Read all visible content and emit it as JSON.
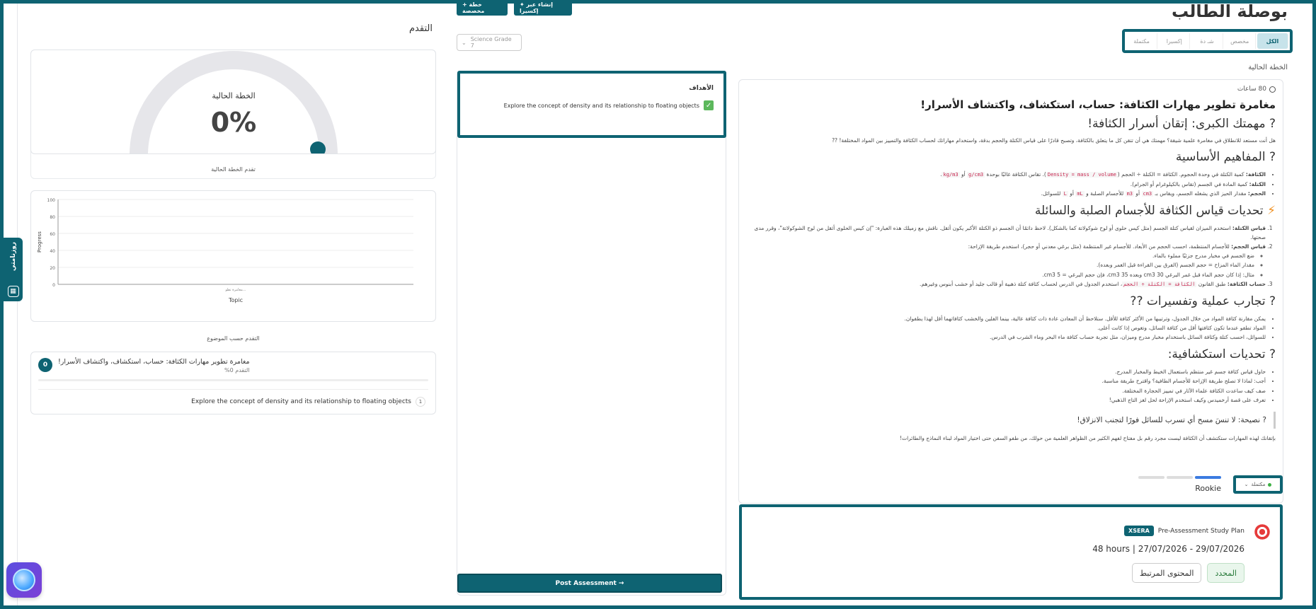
{
  "header": {
    "title": "بوصلة الطالب",
    "filters": [
      "الكل",
      "مخصص",
      "شـ دة",
      "إكسيرا",
      "مكتملة"
    ],
    "current_plan_label": "الخطة الحالية",
    "create_xsera_btn": "✦ إنشاء عبر إكسيرا",
    "custom_plan_btn": "+ خطة مخصصة",
    "grade_select": "Science Grade 7"
  },
  "lesson": {
    "hours": "80 ساعات",
    "title": "مغامرة تطوير مهارات الكثافة: حساب، استكشاف، واكتشاف الأسرار!",
    "mission_heading": "? مهمتك الكبرى: إتقان أسرار الكثافة!",
    "mission_text": "هل أنت مستعد للانطلاق في مغامرة علمية شيقة؟ مهمتك هي أن تتقن كل ما يتعلق بالكثافة، وتصبح قادرًا على قياس الكتلة والحجم بدقة، واستخدام مهاراتك لحساب الكثافة والتمييز بين المواد المختلفة! ??",
    "concepts_heading": "? المفاهيم الأساسية",
    "concepts": [
      {
        "term": "الكثافة:",
        "text": "كمية الكتلة في وحدة الحجوم. الكثافة = الكتلة ÷ الحجم (",
        "code1": "Density = mass / volume",
        "mid": "). تقاس الكثافة غالبًا بوحدة ",
        "code2": "g/cm3",
        "or": " أو ",
        "code3": "kg/m3",
        "end": "."
      },
      {
        "term": "الكتلة:",
        "text": "كمية المادة في الجسم (تقاس بالكيلوغرام أو الجرام)."
      },
      {
        "term": "الحجم:",
        "text": "مقدار الحيز الذي يشغله الجسم، ويقاس بـ ",
        "code1": "cm3",
        "or": " أو ",
        "code2": "m3",
        "mid": " للأجسام الصلبة و ",
        "code3": "mL",
        "or2": " أو ",
        "code4": "L",
        "end": " للسوائل."
      }
    ],
    "challenges_heading": "تحديات قياس الكثافة للأجسام الصلبة والسائلة",
    "challenges": [
      {
        "term": "قياس الكتلة:",
        "text": "استخدم الميزان لقياس كتلة الجسم (مثل كيس حلوى أو لوح شوكولاتة كما بالشكل). لاحظ دائمًا أن الجسم ذو الكتلة الأكبر يكون أثقل. ناقش مع زميلك هذه العبارة: \"إن كيس الحلوى أثقل من لوح الشوكولاتة\"، وقرر مدى صحتها."
      },
      {
        "term": "قياس الحجم:",
        "text": "للأجسام المنتظمة، احسب الحجم من الأبعاد. للأجسام غير المنتظمة (مثل برغي معدني أو حجر)، استخدم طريقة الإزاحة:",
        "sub": [
          "ضع الجسم في مخبار مدرج جزئيًا مملوء بالماء.",
          "مقدار الماء المزاح = حجم الجسم (الفرق بين القراءة قبل الغمر وبعده).",
          "مثال: إذا كان حجم الماء قبل غمر البرغي 30 cm3 وبعده 35 cm3، فإن حجم البرغي = 5 cm3."
        ]
      },
      {
        "term": "حساب الكثافة:",
        "text": "طبق القانون ",
        "code1": "الكثافة = الكتلة ÷ الحجم",
        "end": "، استخدم الجدول في الدرس لحساب كثافة كتلة ذهبية أو قالب جليد أو خشب أبنوس وغيرهم."
      }
    ],
    "experiments_heading": "? تجارب عملية وتفسيرات ??",
    "experiments": [
      "يمكن مقارنة كثافة المواد من خلال الجدول، وترتيبها من الأكثر كثافة للأقل. ستلاحظ أن المعادن عادة ذات كثافة عالية، بينما الفلين والخشب كثافاتهما أقل لهذا يطفوان.",
      "المواد تطفو عندما تكون كثافتها أقل من كثافة السائل، وتغوص إذا كانت أعلى.",
      "للسوائل، احسب كتلة وكثافة السائل باستخدام مخبار مدرج وميزان، مثل تجربة حساب كثافة ماء البحر وماء الشرب في الدرس."
    ],
    "exploration_heading": "? تحديات استكشافية:",
    "exploration": [
      "حاول قياس كثافة جسم غير منتظم باستعمال الخيط والمخبار المدرج.",
      "أجب: لماذا لا تصلح طريقة الإزاحة للأجسام الطافية؟ واقترح طريقة مناسبة.",
      "صف كيف ساعدت الكثافة علماء الآثار في تمييز الحجارة المختلفة.",
      "تعرف على قصة أرخميدس وكيف استخدم الإزاحة لحل لغز التاج الذهبي!"
    ],
    "tip": "? نصيحة: لا تنسَ مسح أي تسرب للسائل فورًا لتجنب الانزلاق!",
    "closing": "بإتقانك لهذه المهارات ستكتشف أن الكثافة ليست مجرد رقم بل مفتاح لفهم الكثير من الظواهر العلمية من حولك، من طفو السفن حتى اختيار المواد لبناء النماذج والطائرات!",
    "level": "Rookie",
    "status": "مكتملة",
    "level_filled": 1
  },
  "plan": {
    "title": "Pre-Assessment Study Plan",
    "badge": "XSERA",
    "dates": "48 hours | 27/07/2026 - 29/07/2026",
    "selected_btn": "المحدد",
    "related_btn": "المحتوى المرتبط"
  },
  "objectives": {
    "title": "الأهداف",
    "items": [
      "Explore the concept of density and its relationship to floating objects"
    ],
    "post_btn": "Post Assessment →"
  },
  "progress": {
    "title": "التقدم",
    "gauge_label": "الخطة الحالية",
    "gauge_value": "0%",
    "gauge_caption": "تقدم الخطة الحالية",
    "chart_caption": "التقدم حسب الموضوع",
    "topic_title": "مغامرة تطوير مهارات الكثافة: حساب، استكشاف، واكتشاف الأسرار!",
    "topic_pct": "التقدم 0%",
    "topic_num": "0",
    "objective_num": "1",
    "objective_text": "Explore the concept of density and its relationship to floating objects"
  },
  "side_tab": {
    "label": "روزنامتي"
  },
  "chart_data": {
    "type": "bar",
    "categories": [
      "مغامرة تطو..."
    ],
    "values": [
      0
    ],
    "xlabel": "Topic",
    "ylabel": "Progress",
    "ylim": [
      0,
      100
    ],
    "yticks": [
      0,
      20,
      40,
      60,
      80,
      100
    ]
  },
  "colors": {
    "accent": "#0e6372",
    "success": "#5cb85c"
  }
}
